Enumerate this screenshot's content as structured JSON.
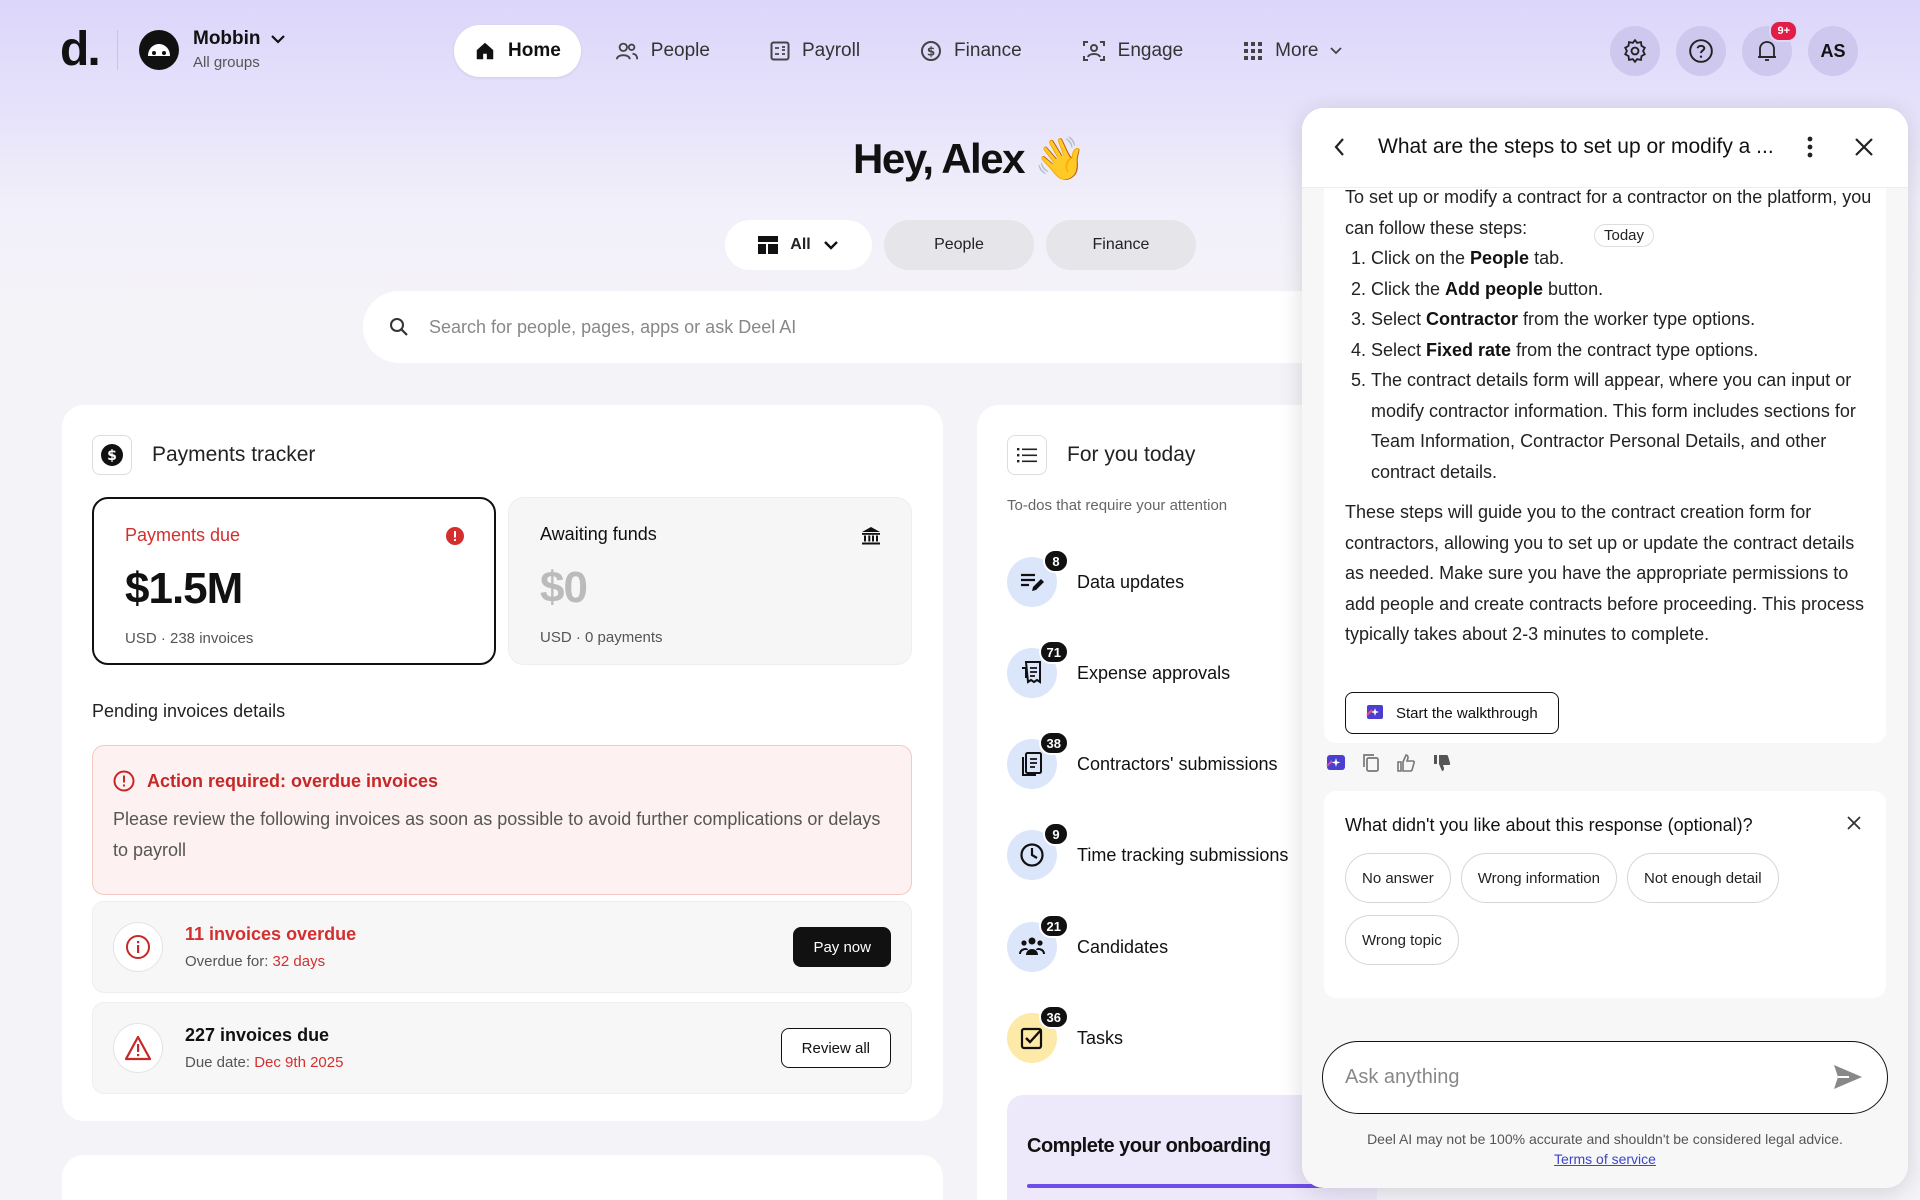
{
  "app": {
    "logo": "d."
  },
  "org": {
    "name": "Mobbin",
    "subtitle": "All groups"
  },
  "nav": {
    "items": [
      {
        "label": "Home",
        "icon": "home-icon"
      },
      {
        "label": "People",
        "icon": "people-icon"
      },
      {
        "label": "Payroll",
        "icon": "payroll-icon"
      },
      {
        "label": "Finance",
        "icon": "dollar-icon"
      },
      {
        "label": "Engage",
        "icon": "engage-icon"
      },
      {
        "label": "More",
        "icon": "grid-icon"
      }
    ],
    "notification_badge": "9+",
    "avatar_initials": "AS"
  },
  "greeting": "Hey, Alex 👋",
  "filters": {
    "all": "All",
    "people": "People",
    "finance": "Finance"
  },
  "search": {
    "placeholder": "Search for people, pages, apps or ask Deel AI"
  },
  "payments": {
    "title": "Payments tracker",
    "due": {
      "label": "Payments due",
      "amount": "$1.5M",
      "sub": "USD · 238 invoices"
    },
    "awaiting": {
      "label": "Awaiting funds",
      "amount": "$0",
      "sub": "USD · 0 payments"
    },
    "pending_title": "Pending invoices details",
    "alert": {
      "title": "Action required: overdue invoices",
      "body": "Please review the following invoices as soon as possible to avoid further complications or delays to payroll"
    },
    "overdue": {
      "title": "11 invoices overdue",
      "sub_label": "Overdue for: ",
      "sub_value": "32 days",
      "button": "Pay now"
    },
    "due_row": {
      "title": "227 invoices due",
      "sub_label": "Due date: ",
      "sub_value": "Dec 9th 2025",
      "button": "Review all"
    }
  },
  "todo": {
    "title": "For you today",
    "subtitle": "To-dos that require your attention",
    "items": [
      {
        "label": "Data updates",
        "count": "8"
      },
      {
        "label": "Expense approvals",
        "count": "71"
      },
      {
        "label": "Contractors' submissions",
        "count": "38"
      },
      {
        "label": "Time tracking submissions",
        "count": "9"
      },
      {
        "label": "Candidates",
        "count": "21"
      },
      {
        "label": "Tasks",
        "count": "36"
      }
    ],
    "onboarding": "Complete your onboarding"
  },
  "ai": {
    "title": "What are the steps to set up or modify a ...",
    "intro": "To set up or modify a contract for a contractor on the platform, you can follow these steps:",
    "today": "Today",
    "steps": [
      {
        "pre": "Click on the ",
        "bold": "People",
        "post": " tab."
      },
      {
        "pre": "Click the ",
        "bold": "Add people",
        "post": " button."
      },
      {
        "pre": "Select ",
        "bold": "Contractor",
        "post": " from the worker type options."
      },
      {
        "pre": "Select ",
        "bold": "Fixed rate",
        "post": " from the contract type options."
      },
      {
        "pre": "The contract details form will appear, where you can input or modify contractor information. This form includes sections for Team Information, Contractor Personal Details, and other contract details.",
        "bold": "",
        "post": ""
      }
    ],
    "closing": "These steps will guide you to the contract creation form for contractors, allowing you to set up or update the contract details as needed. Make sure you have the appropriate permissions to add people and create contracts before proceeding. This process typically takes about 2-3 minutes to complete.",
    "walkthrough": "Start the walkthrough",
    "feedback": {
      "title": "What didn't you like about this response (optional)?",
      "options": [
        "No answer",
        "Wrong information",
        "Not enough detail",
        "Wrong topic"
      ]
    },
    "ask_placeholder": "Ask anything",
    "disclaimer": "Deel AI may not be 100% accurate and shouldn't be considered legal advice.",
    "terms": "Terms of service"
  }
}
